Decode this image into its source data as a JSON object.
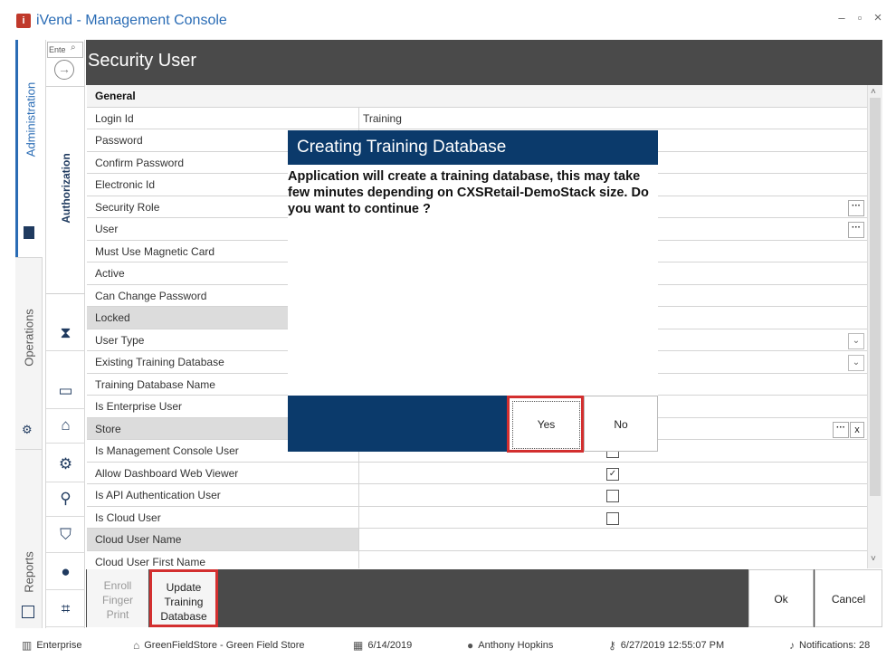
{
  "window": {
    "title": "iVend - Management Console",
    "icon": "app-logo-icon",
    "controls": [
      "minimize-icon",
      "maximize-icon",
      "close-icon"
    ],
    "minimize": "–",
    "maximize": "▫",
    "close": "×"
  },
  "nav": {
    "administration": "Administration",
    "operations": "Operations",
    "reports": "Reports"
  },
  "search": {
    "placeholder": "Ente"
  },
  "page": {
    "title": "Security User"
  },
  "side": {
    "authorization": "Authorization"
  },
  "grid": {
    "section_general": "General",
    "rows": [
      {
        "label": "Login Id",
        "value": "Training"
      },
      {
        "label": "Password",
        "value": ""
      },
      {
        "label": "Confirm Password",
        "value": ""
      },
      {
        "label": "Electronic Id",
        "value": ""
      },
      {
        "label": "Security Role",
        "value": ""
      },
      {
        "label": "User",
        "value": ""
      },
      {
        "label": "Must Use Magnetic Card",
        "value": ""
      },
      {
        "label": "Active",
        "value": ""
      },
      {
        "label": "Can Change Password",
        "value": ""
      },
      {
        "label": "Locked",
        "value": ""
      },
      {
        "label": "User Type",
        "value": ""
      },
      {
        "label": "Existing Training Database",
        "value": ""
      },
      {
        "label": "Training Database Name",
        "value": ""
      },
      {
        "label": "Is Enterprise User",
        "value": ""
      },
      {
        "label": "Store",
        "value": ""
      },
      {
        "label": "Is Management Console User",
        "value": ""
      },
      {
        "label": "Allow Dashboard Web Viewer",
        "value": ""
      },
      {
        "label": "Is API Authentication User",
        "value": ""
      },
      {
        "label": "Is Cloud User",
        "value": ""
      },
      {
        "label": "Cloud User Name",
        "value": ""
      },
      {
        "label": "Cloud User First Name",
        "value": ""
      }
    ],
    "ellipsis": "···",
    "clear": "x",
    "dropdown": "⌄",
    "checkmark": "✓"
  },
  "dialog": {
    "title": "Creating Training Database",
    "message": "Application will create a training database, this may take few minutes depending on CXSRetail-DemoStack size. Do you want to continue ?",
    "yes": "Yes",
    "no": "No"
  },
  "toolbar": {
    "enroll": "Enroll\nFinger\nPrint",
    "update": "Update\nTraining\nDatabase",
    "ok": "Ok",
    "cancel": "Cancel"
  },
  "status": {
    "enterprise": "Enterprise",
    "store": "GreenFieldStore - Green Field Store",
    "date": "6/14/2019",
    "user": "Anthony Hopkins",
    "login_time": "6/27/2019 12:55:07 PM",
    "notifications": "Notifications: 28"
  },
  "colors": {
    "accent": "#0b3a6b",
    "header": "#4a4a4a",
    "title_text": "#2a6cb5",
    "highlight": "#d32f2f"
  }
}
